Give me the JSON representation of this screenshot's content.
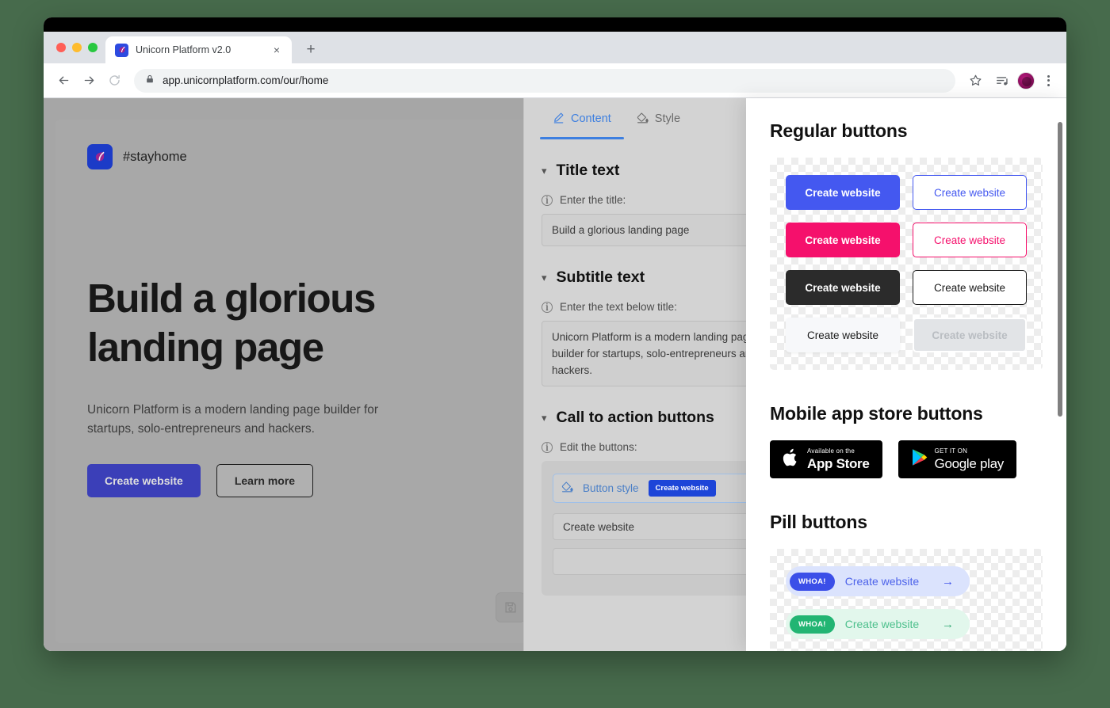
{
  "browser": {
    "tab": {
      "title": "Unicorn Platform v2.0",
      "favicon": "unicorn-logo-icon",
      "close": "×"
    },
    "new_tab_label": "+",
    "url": "app.unicornplatform.com/our/home",
    "icons": {
      "back": "back-arrow-icon",
      "forward": "forward-arrow-icon",
      "reload": "reload-icon",
      "lock": "lock-icon",
      "bookmark": "star-icon",
      "media": "playlist-icon",
      "profile": "avatar-icon",
      "menu": "kebab-menu-icon"
    }
  },
  "preview": {
    "brand_name": "#stayhome",
    "hero_title": "Build a glorious landing page",
    "hero_subtitle": "Unicorn Platform is a modern landing page builder for startups, solo-entrepreneurs and hackers.",
    "cta_primary": "Create website",
    "cta_secondary": "Learn more",
    "save_icon": "save-disk-icon"
  },
  "editor": {
    "tabs": [
      {
        "label": "Content",
        "icon": "pencil-icon",
        "active": true
      },
      {
        "label": "Style",
        "icon": "paint-bucket-icon",
        "active": false
      }
    ],
    "sections": [
      {
        "title": "Title text",
        "hint": "Enter the title:",
        "value": "Build a glorious landing page"
      },
      {
        "title": "Subtitle text",
        "hint": "Enter the text below title:",
        "value": "Unicorn Platform is a modern landing page builder for startups, solo-entrepreneurs and hackers."
      },
      {
        "title": "Call to action buttons",
        "hint": "Edit the buttons:",
        "button_style_label": "Button style",
        "button_style_chip": "Create website",
        "button_value": "Create website"
      }
    ]
  },
  "panel": {
    "sections": [
      {
        "heading": "Regular buttons",
        "buttons": [
          {
            "label": "Create website",
            "variant": "blue-fill"
          },
          {
            "label": "Create website",
            "variant": "blue-out"
          },
          {
            "label": "Create website",
            "variant": "pink-fill"
          },
          {
            "label": "Create website",
            "variant": "pink-out"
          },
          {
            "label": "Create website",
            "variant": "dark-fill"
          },
          {
            "label": "Create website",
            "variant": "dark-out"
          },
          {
            "label": "Create website",
            "variant": "white-fill"
          },
          {
            "label": "Create website",
            "variant": "gray-fill"
          }
        ]
      },
      {
        "heading": "Mobile app store buttons",
        "stores": [
          {
            "small": "Available on the",
            "big": "App Store",
            "icon": "apple-icon"
          },
          {
            "small": "GET IT ON",
            "big": "Google play",
            "icon": "google-play-icon"
          }
        ]
      },
      {
        "heading": "Pill buttons",
        "pills": [
          {
            "badge": "WHOA!",
            "label": "Create website",
            "arrow": "→",
            "color": "blue"
          },
          {
            "badge": "WHOA!",
            "label": "Create website",
            "arrow": "→",
            "color": "green"
          }
        ]
      }
    ]
  },
  "colors": {
    "accent_blue": "#4458f0",
    "accent_pink": "#f5106c",
    "accent_green": "#22b573",
    "tab_active": "#3d7fe0",
    "desktop_bg": "#476b4c",
    "preview_bg": "#a6a6a6",
    "editor_bg": "#d3d3d3"
  }
}
